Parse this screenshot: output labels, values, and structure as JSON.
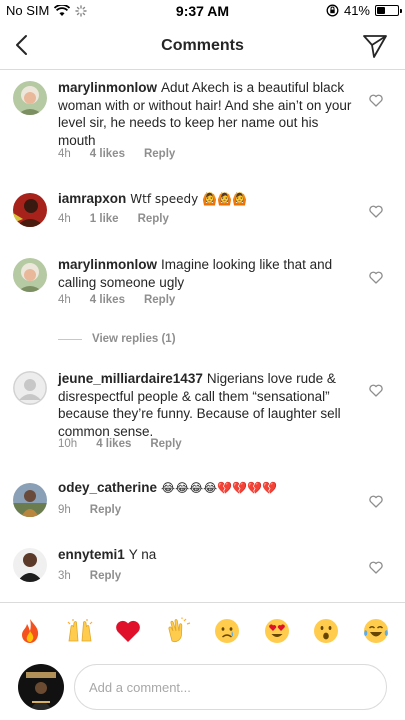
{
  "status_bar": {
    "carrier": "No SIM",
    "time": "9:37 AM",
    "battery": "41%",
    "battery_level": 0.41
  },
  "header": {
    "title": "Comments"
  },
  "comments": [
    {
      "username": "marylinmonlow",
      "text": "Adut Akech is a beautiful black woman with or without hair! And she ain’t on your level sir, he needs to keep her name out his mouth",
      "time": "4h",
      "likes": "4 likes",
      "reply": "Reply"
    },
    {
      "username": "iamrapxon",
      "text": "Wtf speedy 🙆🙆🙆",
      "time": "4h",
      "likes": "1 like",
      "reply": "Reply"
    },
    {
      "username": "marylinmonlow",
      "text": "Imagine looking like that and calling someone ugly",
      "time": "4h",
      "likes": "4 likes",
      "reply": "Reply"
    },
    {
      "username": "jeune_milliardaire1437",
      "text": "Nigerians love rude & disrespectful people & call them “sensational” because they’re funny. Because of laughter sell common sense.",
      "time": "10h",
      "likes": "4 likes",
      "reply": "Reply"
    },
    {
      "username": "odey_catherine",
      "text": "😂😂😂😂💔💔💔💔",
      "time": "9h",
      "likes": "",
      "reply": "Reply"
    },
    {
      "username": "ennytemi1",
      "text": "Y na",
      "time": "3h",
      "likes": "",
      "reply": "Reply"
    }
  ],
  "view_replies": "View replies (1)",
  "emoji_bar": [
    "fire-icon",
    "raised-hands-icon",
    "red-heart-icon",
    "clapping-hands-icon",
    "crying-face-icon",
    "heart-eyes-icon",
    "surprised-face-icon",
    "tears-of-joy-icon"
  ],
  "composer": {
    "placeholder": "Add a comment...",
    "value": ""
  },
  "colors": {
    "text": "#262626",
    "muted": "#8e8e8e",
    "divider": "#dbdbdb"
  }
}
